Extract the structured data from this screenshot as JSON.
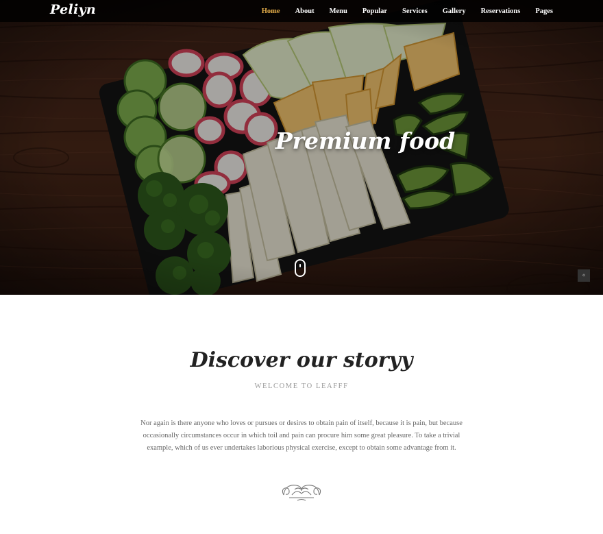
{
  "header": {
    "logo": "Peliyn",
    "nav": [
      {
        "label": "Home",
        "active": true
      },
      {
        "label": "About",
        "active": false
      },
      {
        "label": "Menu",
        "active": false
      },
      {
        "label": "Popular",
        "active": false
      },
      {
        "label": "Services",
        "active": false
      },
      {
        "label": "Gallery",
        "active": false
      },
      {
        "label": "Reservations",
        "active": false
      },
      {
        "label": "Pages",
        "active": false
      }
    ]
  },
  "hero": {
    "title": "Premium food",
    "scroll_icon": "mouse-scroll-icon",
    "back_to_top_icon": "double-chevron-up-icon",
    "back_to_top_symbol": "«"
  },
  "story": {
    "title": "Discover our storyy",
    "subtitle": "WELCOME TO LEAFFF",
    "body": "Nor again is there anyone who loves or pursues or desires to obtain pain of itself, because it is pain, but because occasionally circumstances occur in which toil and pain can procure him some great pleasure. To take a trivial example, which of us ever undertakes laborious physical exercise, except to obtain some advantage from it.",
    "ornament_icon": "ornament-divider-icon"
  },
  "colors": {
    "accent": "#e8b04a",
    "navbar": "#0b0b0b",
    "wood": "#3a1f14",
    "text": "#666666"
  }
}
